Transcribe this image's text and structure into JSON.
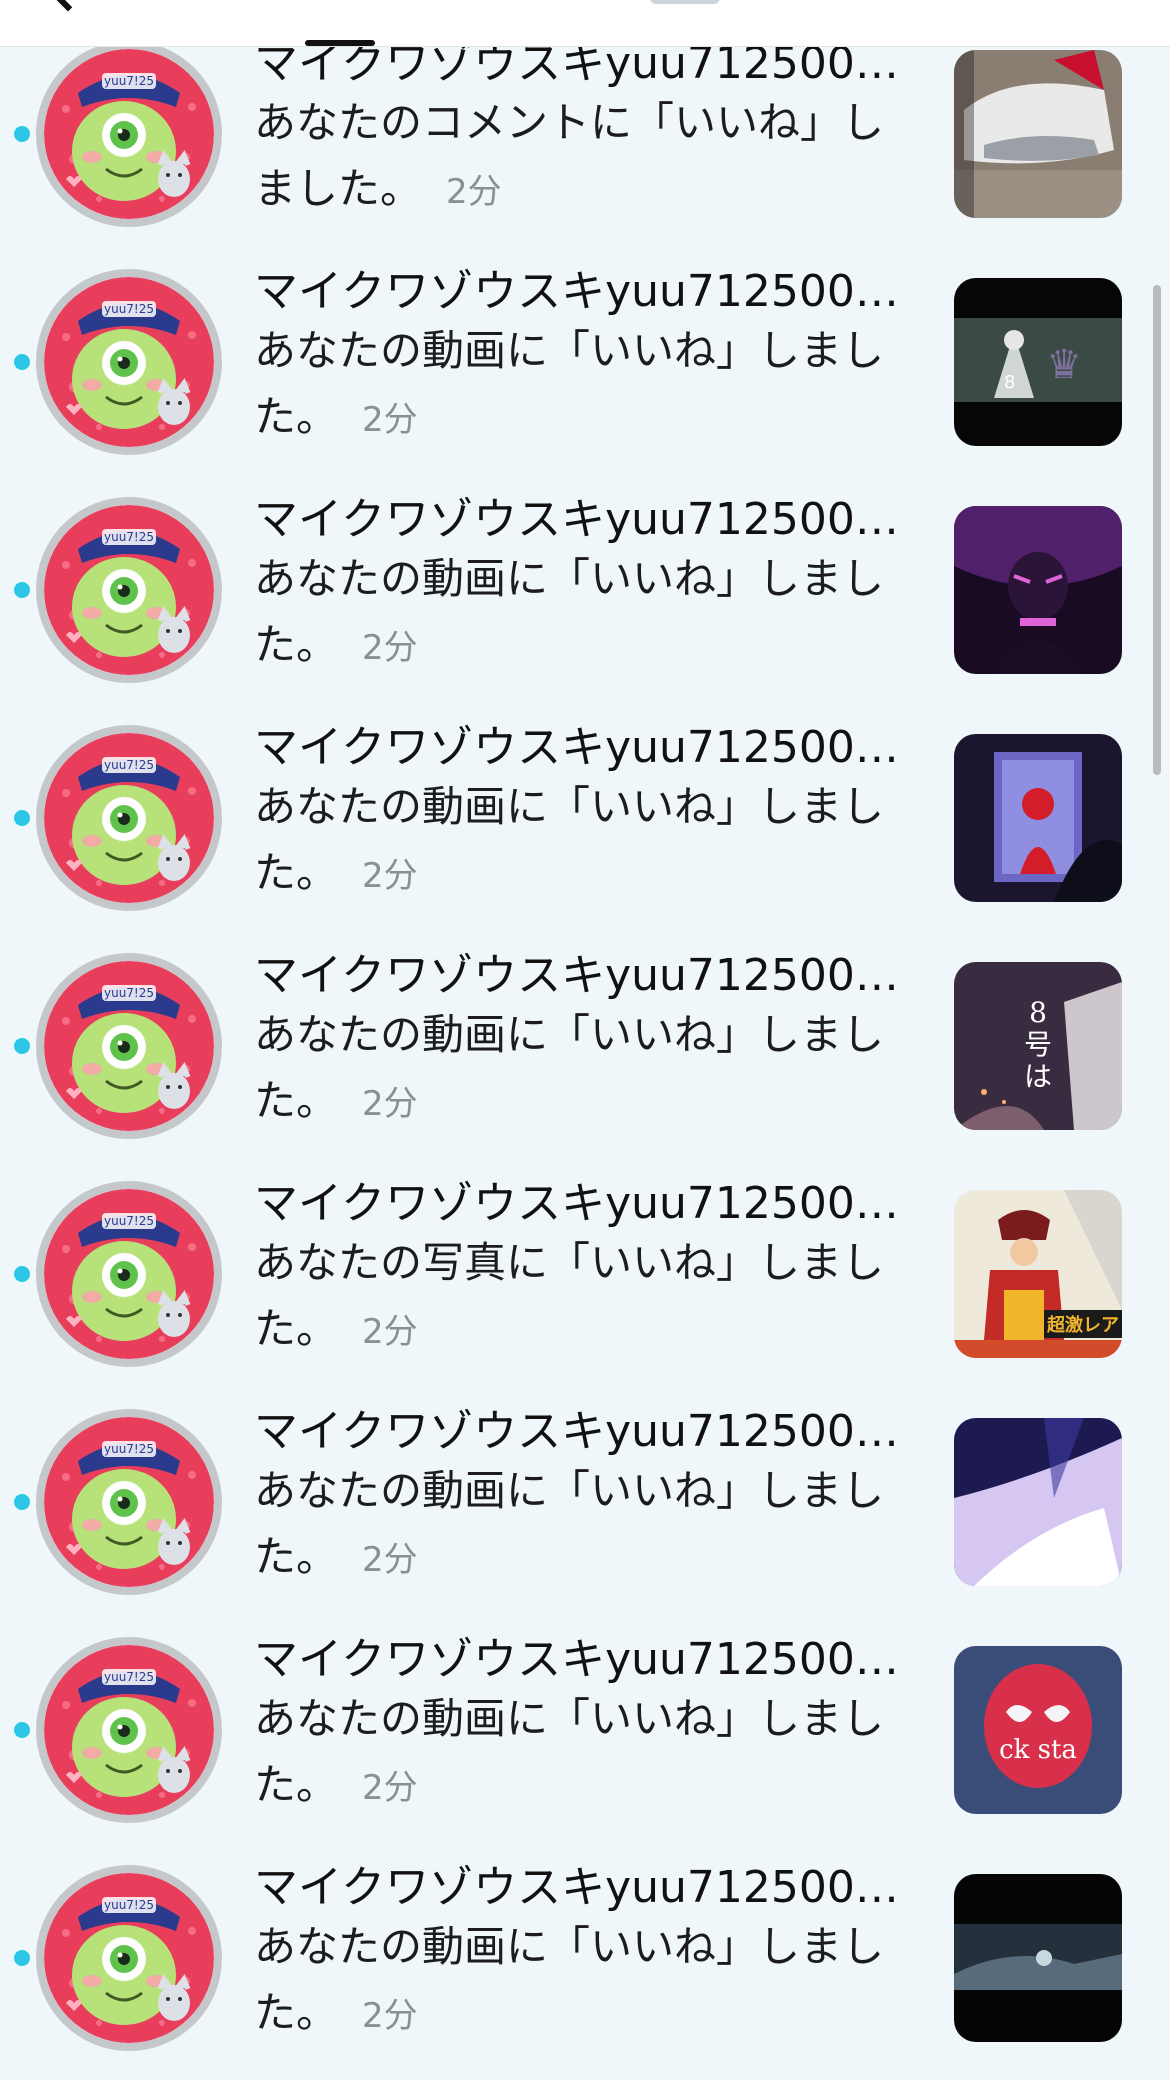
{
  "notifications": [
    {
      "username": "マイクワゾウスキyuu712500🦖…",
      "message": "あなたのコメントに「いいね」しました。",
      "time": "2分",
      "unread": true,
      "avatar_icon": "mike-wazowski-avatar-icon",
      "thumbnail": {
        "icon": "sneaker-thumbnail",
        "colors": [
          "#8a7d72",
          "#e9e9ea",
          "#c8102e"
        ]
      }
    },
    {
      "username": "マイクワゾウスキyuu712500🦖…",
      "message": "あなたの動画に「いいね」しました。",
      "time": "2分",
      "unread": true,
      "avatar_icon": "mike-wazowski-avatar-icon",
      "thumbnail": {
        "icon": "anime-scene-thumbnail",
        "colors": [
          "#060607",
          "#3b4a44",
          "#8e7bb5"
        ]
      }
    },
    {
      "username": "マイクワゾウスキyuu712500🦖…",
      "message": "あなたの動画に「いいね」しました。",
      "time": "2分",
      "unread": true,
      "avatar_icon": "mike-wazowski-avatar-icon",
      "thumbnail": {
        "icon": "purple-character-thumbnail",
        "colors": [
          "#1a0b24",
          "#6a2a8a",
          "#e064d8"
        ]
      }
    },
    {
      "username": "マイクワゾウスキyuu712500🦖…",
      "message": "あなたの動画に「いいね」しました。",
      "time": "2分",
      "unread": true,
      "avatar_icon": "mike-wazowski-avatar-icon",
      "thumbnail": {
        "icon": "spiderman-door-thumbnail",
        "colors": [
          "#1b1530",
          "#6c67c4",
          "#d41d2a"
        ]
      }
    },
    {
      "username": "マイクワゾウスキyuu712500🦖…",
      "message": "あなたの動画に「いいね」しました。",
      "time": "2分",
      "unread": true,
      "avatar_icon": "mike-wazowski-avatar-icon",
      "thumbnail": {
        "icon": "kaiju-text-thumbnail",
        "colors": [
          "#3a2c40",
          "#7c5e6c",
          "#e8e2e6"
        ],
        "overlay_text": "8号は"
      }
    },
    {
      "username": "マイクワゾウスキyuu712500🦖…",
      "message": "あなたの写真に「いいね」しました。",
      "time": "2分",
      "unread": true,
      "avatar_icon": "mike-wazowski-avatar-icon",
      "thumbnail": {
        "icon": "pirate-card-thumbnail",
        "colors": [
          "#efe9dc",
          "#c22b26",
          "#f0b52b"
        ],
        "overlay_text": "超激レア"
      }
    },
    {
      "username": "マイクワゾウスキyuu712500🦖…",
      "message": "あなたの動画に「いいね」しました。",
      "time": "2分",
      "unread": true,
      "avatar_icon": "mike-wazowski-avatar-icon",
      "thumbnail": {
        "icon": "anime-glow-thumbnail",
        "colors": [
          "#1c1a50",
          "#d5c7f1",
          "#ffffff"
        ]
      }
    },
    {
      "username": "マイクワゾウスキyuu712500🦖…",
      "message": "あなたの動画に「いいね」しました。",
      "time": "2分",
      "unread": true,
      "avatar_icon": "mike-wazowski-avatar-icon",
      "thumbnail": {
        "icon": "spiderman-mask-thumbnail",
        "colors": [
          "#3a4d78",
          "#d8304a",
          "#f4f4f6"
        ],
        "overlay_text": "ck sta"
      }
    },
    {
      "username": "マイクワゾウスキyuu712500🦖…",
      "message": "あなたの動画に「いいね」しました。",
      "time": "2分",
      "unread": true,
      "avatar_icon": "mike-wazowski-avatar-icon",
      "thumbnail": {
        "icon": "dark-scene-thumbnail",
        "colors": [
          "#050505",
          "#24313c",
          "#6d8595"
        ]
      }
    }
  ],
  "colors": {
    "unread_dot": "#2cc6e6",
    "background": "#eff7fb",
    "avatar_bg": "#e83e5c",
    "avatar_monster": "#b7e27a",
    "time_text": "#8a8f94"
  }
}
